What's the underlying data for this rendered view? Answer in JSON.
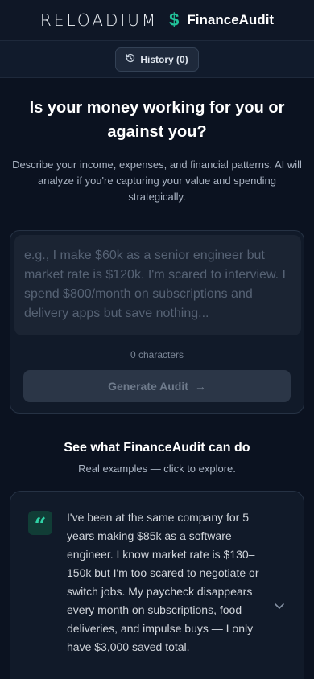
{
  "header": {
    "logo_text": "RELOADIUM",
    "currency_symbol": "$",
    "app_name": "FinanceAudit"
  },
  "history": {
    "label": "History (0)"
  },
  "hero": {
    "title": "Is your money working for you or against you?",
    "subtitle": "Describe your income, expenses, and financial patterns. AI will analyze if you're capturing your value and spending strategically."
  },
  "input": {
    "value": "",
    "placeholder": "e.g., I make $60k as a senior engineer but market rate is $120k. I'm scared to interview. I spend $800/month on subscriptions and delivery apps but save nothing...",
    "char_count": "0 characters",
    "submit_label": "Generate Audit",
    "submit_icon": "→"
  },
  "examples": {
    "title": "See what FinanceAudit can do",
    "subtitle": "Real examples — click to explore.",
    "items": [
      {
        "icon": "quote-icon",
        "text": "I've been at the same company for 5 years making $85k as a software engineer. I know market rate is $130–150k but I'm too scared to negotiate or switch jobs. My paycheck disappears every month on subscriptions, food deliveries, and impulse buys — I only have $3,000 saved total."
      }
    ]
  },
  "colors": {
    "accent": "#22c39a",
    "background": "#0b1220",
    "card": "#111a29"
  }
}
